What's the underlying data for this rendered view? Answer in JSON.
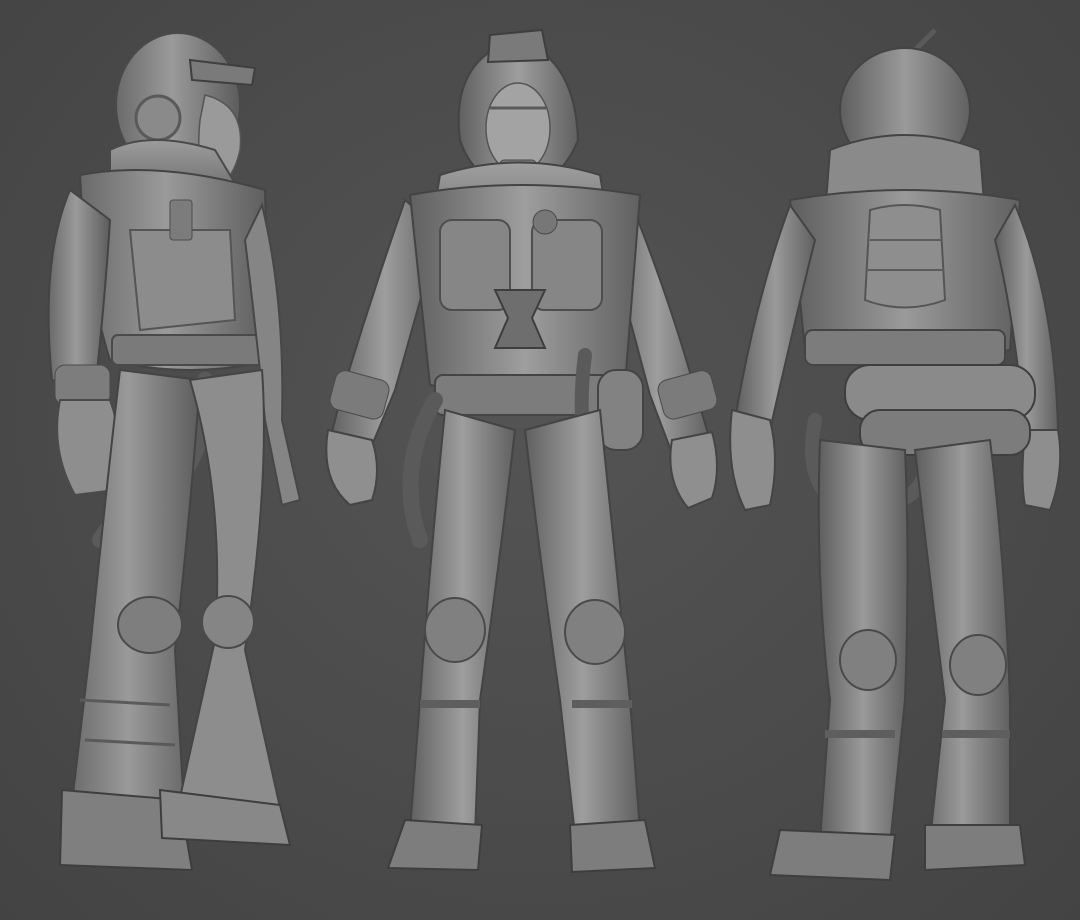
{
  "scene": {
    "background": "#4a4a4a",
    "material": "#8a8a8a",
    "material_dark": "#5e5e5e",
    "material_light": "#a9a9a9",
    "views": [
      {
        "id": "side",
        "icon": "side-view-figure-icon"
      },
      {
        "id": "front",
        "icon": "front-view-figure-icon"
      },
      {
        "id": "back",
        "icon": "back-view-figure-icon"
      }
    ]
  }
}
